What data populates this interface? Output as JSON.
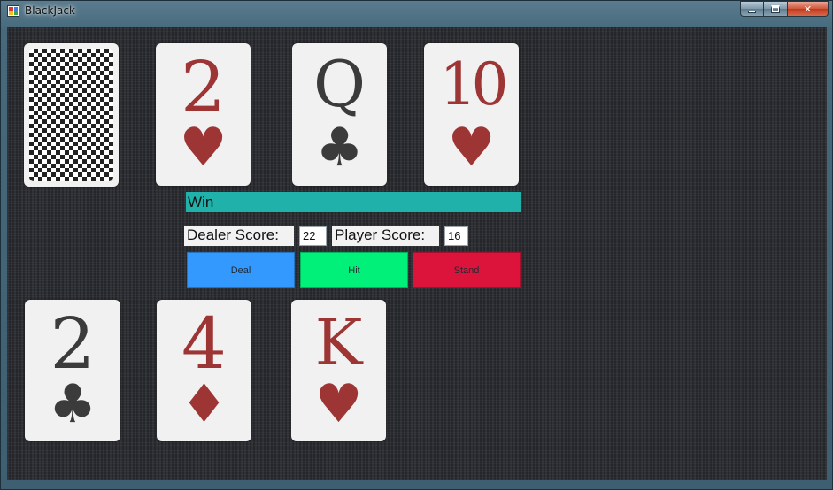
{
  "window": {
    "title": "BlackJack",
    "controls": {
      "minimize": "minimize-icon",
      "maximize": "maximize-icon",
      "close": "✕"
    }
  },
  "dealer": {
    "hidden_card": {
      "back": true
    },
    "cards": [
      {
        "rank": "2",
        "suit": "♥",
        "color": "#9e3535"
      },
      {
        "rank": "Q",
        "suit": "♣",
        "color": "#3b3b3b"
      },
      {
        "rank": "10",
        "suit": "♥",
        "color": "#9e3535"
      }
    ]
  },
  "player": {
    "cards": [
      {
        "rank": "2",
        "suit": "♣",
        "color": "#3b3b3b"
      },
      {
        "rank": "4",
        "suit": "♦",
        "color": "#9e3535"
      },
      {
        "rank": "K",
        "suit": "♥",
        "color": "#9e3535"
      }
    ]
  },
  "status": {
    "text": "Win",
    "color": "#20b2aa"
  },
  "scores": {
    "dealer_label": "Dealer Score:",
    "dealer_value": "22",
    "player_label": "Player Score:",
    "player_value": "16"
  },
  "buttons": {
    "deal": {
      "label": "Deal",
      "color": "#3399ff"
    },
    "hit": {
      "label": "Hit",
      "color": "#00f07a"
    },
    "stand": {
      "label": "Stand",
      "color": "#dc143c"
    }
  }
}
